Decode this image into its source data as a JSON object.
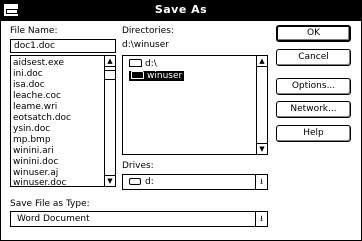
{
  "window": {
    "title": "Save As"
  },
  "file_name": {
    "label": "File Name:",
    "value": "doc1.doc",
    "files": [
      "aidsest.exe",
      "ini.doc",
      "isa.doc",
      "leache.coc",
      "leame.wri",
      "eotsatch.doc",
      "ysin.doc",
      "mp.bmp",
      "winini.ari",
      "winini.doc",
      "winuser.aj",
      "winuser.doc"
    ]
  },
  "directories": {
    "label": "Directories:",
    "path": "d:\\winuser",
    "items": [
      {
        "name": "d:\\",
        "selected": false
      },
      {
        "name": "winuser",
        "selected": true
      }
    ]
  },
  "drives": {
    "label": "Drives:",
    "value": "d:"
  },
  "save_type": {
    "label": "Save File as Type:",
    "value": "Word Document"
  },
  "buttons": {
    "ok": "OK",
    "cancel": "Cancel",
    "options": "Options...",
    "network": "Network...",
    "help": "Help"
  },
  "icons": {
    "system_menu": "system-menu-icon",
    "folder_open": "open-folder-icon",
    "drive": "drive-icon",
    "scroll_up": "scroll-up-arrow-icon",
    "scroll_down": "scroll-down-arrow-icon",
    "dropdown": "dropdown-arrow-icon"
  }
}
